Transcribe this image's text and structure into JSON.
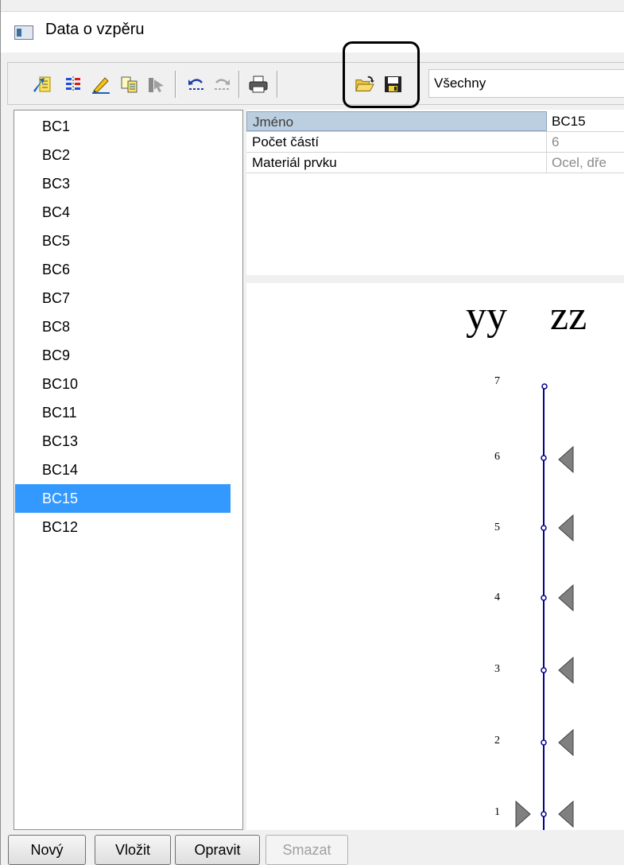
{
  "window": {
    "title": "Data o vzpěru"
  },
  "toolbar": {
    "icons": [
      "new-item-icon",
      "columns-icon",
      "edit-pencil-icon",
      "copy-icon",
      "cursor-icon",
      "undo-icon",
      "redo-icon",
      "print-icon",
      "open-folder-icon",
      "save-icon"
    ],
    "filter_value": "Všechny"
  },
  "list": {
    "items": [
      "BC1",
      "BC2",
      "BC3",
      "BC4",
      "BC5",
      "BC6",
      "BC7",
      "BC8",
      "BC9",
      "BC10",
      "BC11",
      "BC13",
      "BC14",
      "BC15",
      "BC12"
    ],
    "selected": "BC15"
  },
  "properties": {
    "rows": [
      {
        "name": "Jméno",
        "value": "BC15"
      },
      {
        "name": "Počet částí",
        "value": "6"
      },
      {
        "name": "Materiál prvku",
        "value": "Ocel, dře"
      }
    ]
  },
  "diagram": {
    "axis_labels": [
      "yy",
      "zz"
    ],
    "nodes": [
      "7",
      "6",
      "5",
      "4",
      "3",
      "2",
      "1"
    ],
    "accent_color": "#00008b",
    "support_color": "#808080"
  },
  "buttons": {
    "new": "Nový",
    "insert": "Vložit",
    "edit": "Opravit",
    "delete": "Smazat"
  }
}
